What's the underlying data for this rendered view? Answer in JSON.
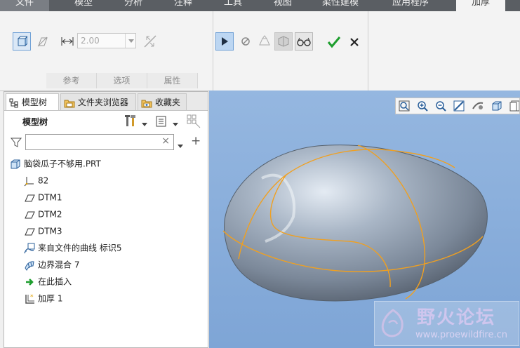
{
  "menu": {
    "tabs": [
      "文件",
      "模型",
      "分析",
      "注释",
      "工具",
      "视图",
      "柔性建模",
      "应用程序",
      "加厚"
    ]
  },
  "ribbon": {
    "thickness_value": "2.00",
    "groups": [
      "参考",
      "选项",
      "属性"
    ]
  },
  "panel": {
    "tabs": [
      "模型树",
      "文件夹浏览器",
      "收藏夹"
    ],
    "header_label": "模型树",
    "filter_clear": "×",
    "add": "+",
    "tree": [
      {
        "label": "脑袋瓜子不够用.PRT",
        "icon": "part-icon"
      },
      {
        "label": "82",
        "icon": "csys-icon"
      },
      {
        "label": "DTM1",
        "icon": "datum-plane-icon"
      },
      {
        "label": "DTM2",
        "icon": "datum-plane-icon"
      },
      {
        "label": "DTM3",
        "icon": "datum-plane-icon"
      },
      {
        "label": "来自文件的曲线 标识5",
        "icon": "curve-file-icon"
      },
      {
        "label": "边界混合 7",
        "icon": "boundary-blend-icon"
      },
      {
        "label": "在此插入",
        "icon": "insert-here-icon"
      },
      {
        "label": "加厚 1",
        "icon": "thicken-icon"
      }
    ]
  },
  "watermark": {
    "title": "野火论坛",
    "url": "www.proewildfire.cn"
  },
  "colors": {
    "accent_blue": "#3b8fd4",
    "check_green": "#1e9e2e",
    "curve_orange": "#f0a020",
    "background_blue": "#8aaedd"
  }
}
